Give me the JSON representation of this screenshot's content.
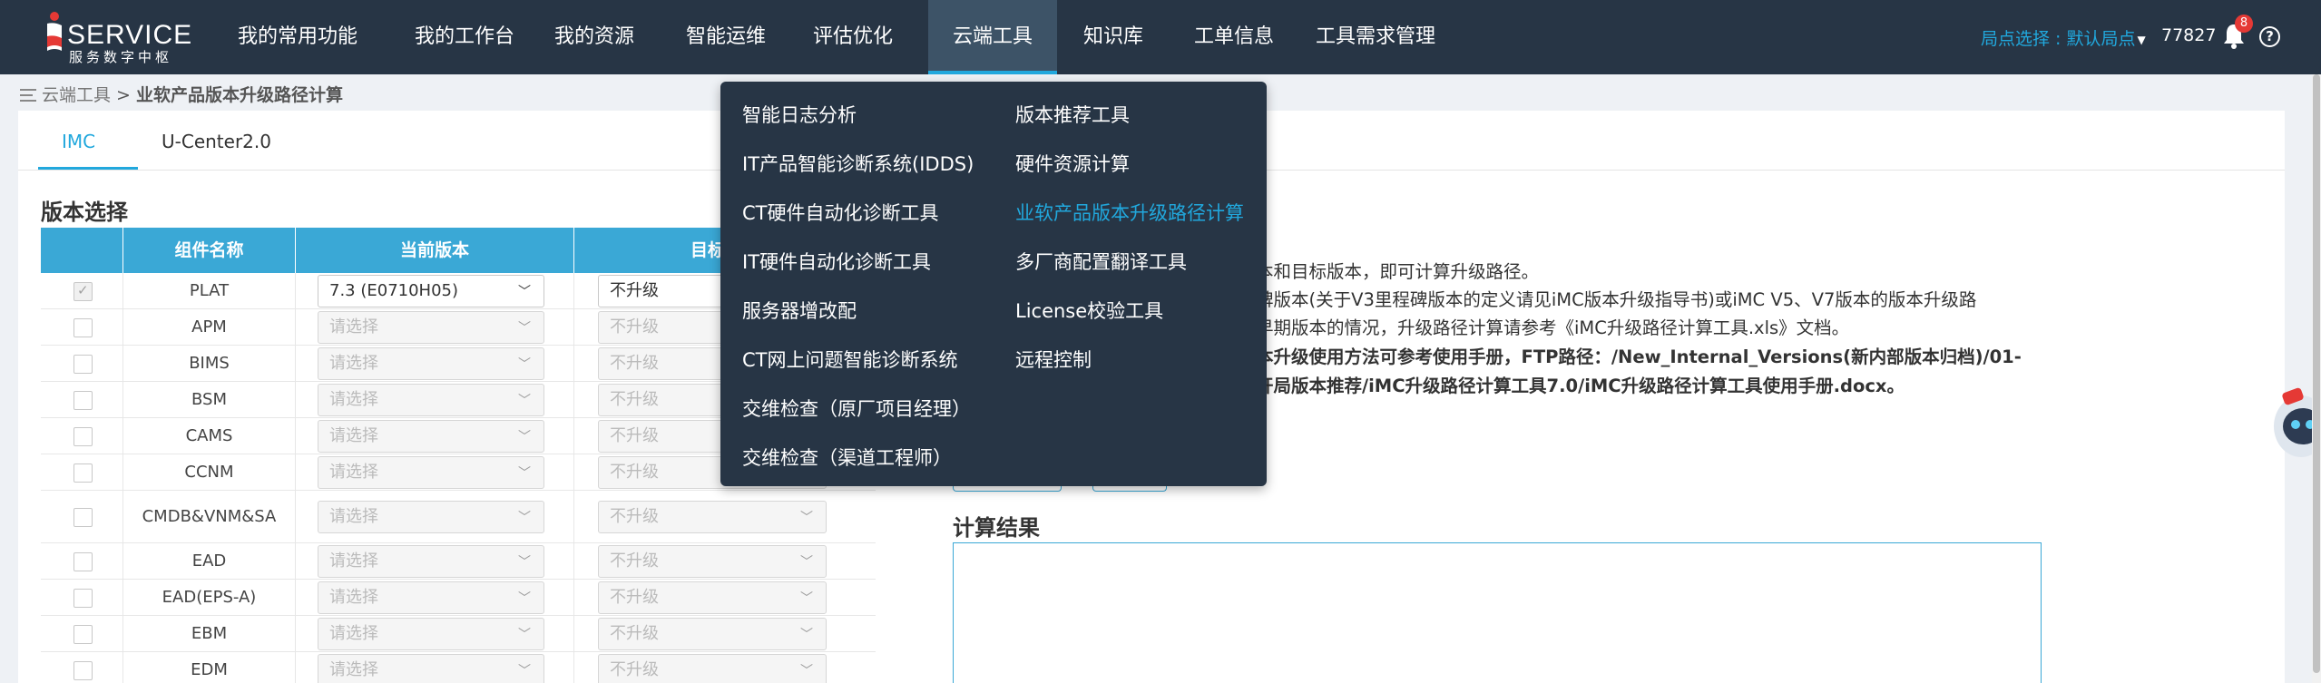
{
  "colors": {
    "nav_bg": "#273545",
    "accent": "#21a8dd",
    "table_header": "#3aa8d6",
    "badge": "#e53935"
  },
  "logo": {
    "word": "SERVICE",
    "sub": "服务数字中枢"
  },
  "nav": {
    "items": [
      "我的常用功能",
      "我的工作台",
      "我的资源",
      "智能运维",
      "评估优化",
      "云端工具",
      "知识库",
      "工单信息",
      "工具需求管理"
    ],
    "active": "云端工具"
  },
  "header": {
    "site_select": "局点选择 : 默认局点",
    "user_id": "77827",
    "notification_count": "8",
    "help": "?"
  },
  "breadcrumb": {
    "parent": "云端工具",
    "separator": ">",
    "current": "业软产品版本升级路径计算"
  },
  "tabs": [
    "IMC",
    "U-Center2.0"
  ],
  "section_title": "版本选择",
  "table": {
    "headers": [
      "组件名称",
      "当前版本",
      "目标版本"
    ],
    "rows": [
      {
        "name": "PLAT",
        "current": "7.3 (E0710H05)",
        "target": "不升级",
        "checked": true,
        "enabled": true
      },
      {
        "name": "APM",
        "current": "请选择",
        "target": "不升级",
        "checked": false,
        "enabled": false
      },
      {
        "name": "BIMS",
        "current": "请选择",
        "target": "不升级",
        "checked": false,
        "enabled": false
      },
      {
        "name": "BSM",
        "current": "请选择",
        "target": "不升级",
        "checked": false,
        "enabled": false
      },
      {
        "name": "CAMS",
        "current": "请选择",
        "target": "不升级",
        "checked": false,
        "enabled": false
      },
      {
        "name": "CCNM",
        "current": "请选择",
        "target": "不升级",
        "checked": false,
        "enabled": false
      },
      {
        "name": "CMDB&VNM&SA",
        "current": "请选择",
        "target": "不升级",
        "checked": false,
        "enabled": false
      },
      {
        "name": "EAD",
        "current": "请选择",
        "target": "不升级",
        "checked": false,
        "enabled": false
      },
      {
        "name": "EAD(EPS-A)",
        "current": "请选择",
        "target": "不升级",
        "checked": false,
        "enabled": false
      },
      {
        "name": "EBM",
        "current": "请选择",
        "target": "不升级",
        "checked": false,
        "enabled": false
      },
      {
        "name": "EDM",
        "current": "请选择",
        "target": "不升级",
        "checked": false,
        "enabled": false
      }
    ]
  },
  "info": {
    "lines": [
      "本和目标版本，即可计算升级路径。",
      "碑版本(关于V3里程碑版本的定义请见iMC版本升级指导书)或iMC V5、V7版本的版本升级路",
      "早期版本的情况，升级路径计算请参考《iMC升级路径计算工具.xls》文档。",
      "本升级使用方法可参考使用手册，FTP路径：/New_Internal_Versions(新内部版本归档)/01-",
      "开局版本推荐/iMC升级路径计算工具7.0/iMC升级路径计算工具使用手册.docx。"
    ]
  },
  "result": {
    "title": "计算结果",
    "content": ""
  },
  "dropdown": {
    "left": [
      "智能日志分析",
      "IT产品智能诊断系统(IDDS)",
      "CT硬件自动化诊断工具",
      "IT硬件自动化诊断工具",
      "服务器增改配",
      "CT网上问题智能诊断系统",
      "交维检查（原厂项目经理）",
      "交维检查（渠道工程师）"
    ],
    "right": [
      "版本推荐工具",
      "硬件资源计算",
      "业软产品版本升级路径计算",
      "多厂商配置翻译工具",
      "License校验工具",
      "远程控制"
    ],
    "active": "业软产品版本升级路径计算"
  }
}
